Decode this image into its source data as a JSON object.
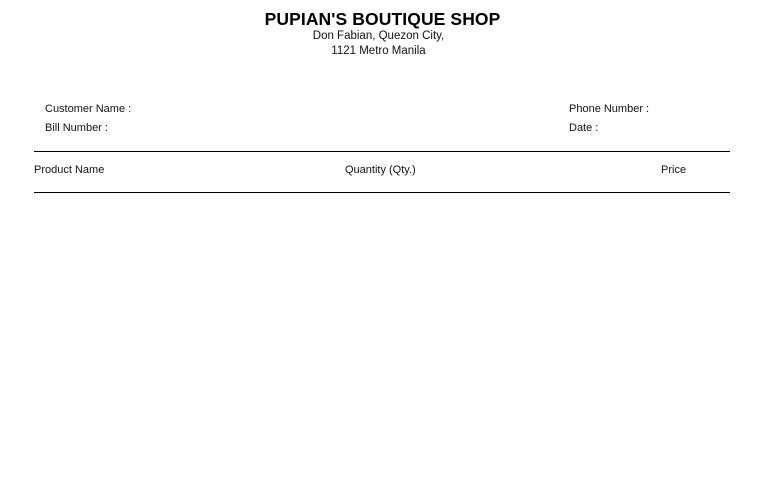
{
  "header": {
    "shop_name": "PUPIAN'S BOUTIQUE SHOP",
    "address_line1": "Don Fabian, Quezon City,",
    "address_line2": "1121 Metro Manila"
  },
  "customer_info": {
    "customer_name_label": "Customer Name :",
    "bill_number_label": "Bill Number :",
    "phone_number_label": "Phone Number :",
    "date_label": "Date :"
  },
  "table": {
    "columns": [
      "Product Name",
      "Quantity (Qty.)",
      "Price"
    ],
    "rows": []
  }
}
